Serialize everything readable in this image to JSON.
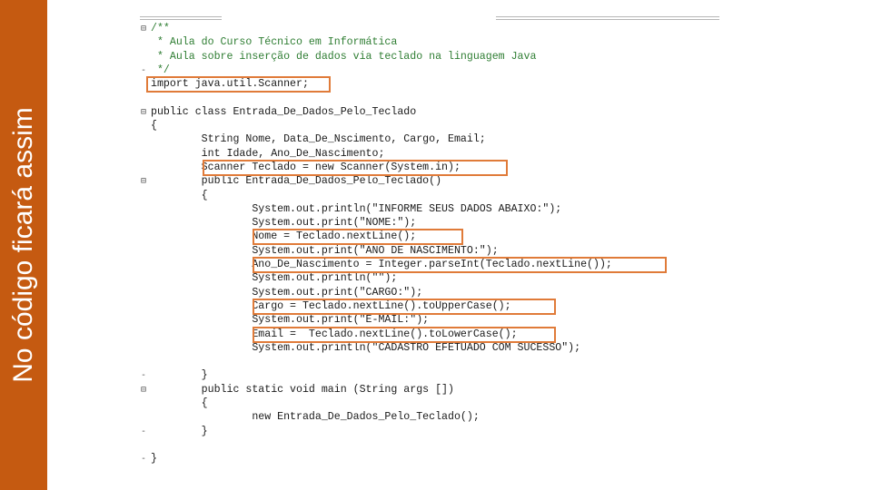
{
  "sidebar": {
    "title": "No código ficará assim"
  },
  "colors": {
    "sidebar": "#c55a11",
    "highlight": "#e07b39",
    "comment": "#2e7d32",
    "code": "#1a1a1a"
  },
  "code": {
    "lines": [
      "/**",
      " * Aula do Curso Técnico em Informática",
      " * Aula sobre inserção de dados via teclado na linguagem Java",
      " */",
      "import java.util.Scanner;",
      "",
      "public class Entrada_De_Dados_Pelo_Teclado",
      "{",
      "        String Nome, Data_De_Nscimento, Cargo, Email;",
      "        int Idade, Ano_De_Nascimento;",
      "        Scanner Teclado = new Scanner(System.in);",
      "        public Entrada_De_Dados_Pelo_Teclado()",
      "        {",
      "                System.out.println(\"INFORME SEUS DADOS ABAIXO:\");",
      "                System.out.print(\"NOME:\");",
      "                Nome = Teclado.nextLine();",
      "                System.out.print(\"ANO DE NASCIMENTO:\");",
      "                Ano_De_Nascimento = Integer.parseInt(Teclado.nextLine());",
      "                System.out.println(\"\");",
      "                System.out.print(\"CARGO:\");",
      "                Cargo = Teclado.nextLine().toUpperCase();",
      "                System.out.print(\"E-MAIL:\");",
      "                Email =  Teclado.nextLine().toLowerCase();",
      "                System.out.println(\"CADASTRO EFETUADO COM SUCESSO\");",
      "",
      "        }",
      "        public static void main (String args [])",
      "        {",
      "                new Entrada_De_Dados_Pelo_Teclado();",
      "        }",
      "",
      "}"
    ]
  }
}
